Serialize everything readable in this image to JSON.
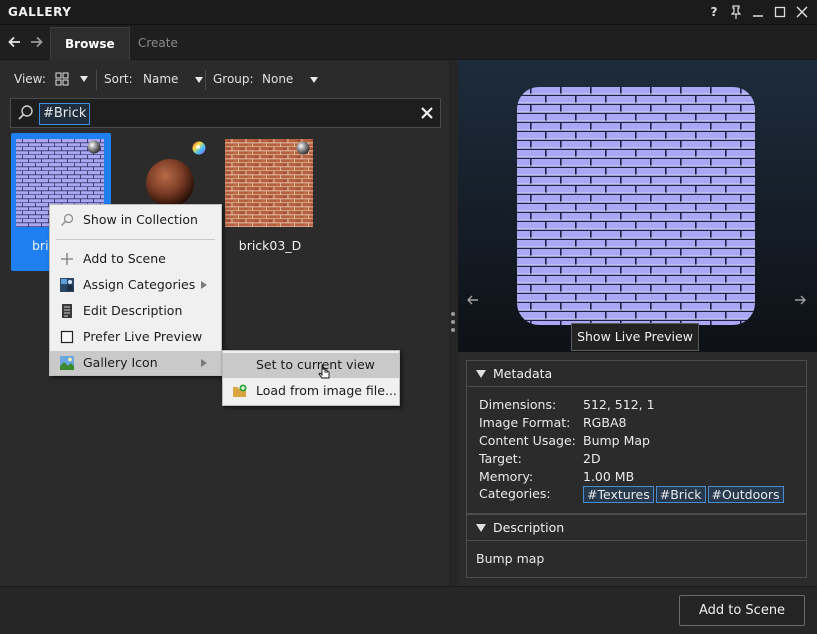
{
  "window": {
    "title": "GALLERY",
    "controls": [
      "?",
      "pin",
      "minimize",
      "maximize",
      "close"
    ]
  },
  "tabs": [
    {
      "label": "Browse",
      "active": true
    },
    {
      "label": "Create",
      "active": false
    }
  ],
  "toolbar": {
    "view_label": "View:",
    "sort_label": "Sort:",
    "sort_value": "Name",
    "group_label": "Group:",
    "group_value": "None"
  },
  "search": {
    "tag": "#Brick"
  },
  "thumbnails": [
    {
      "label": "brick01_N",
      "visible_label": "bric",
      "selected": true,
      "icon": "sphere-icon"
    },
    {
      "label": "",
      "selected": false,
      "icon": "color-wheel-icon"
    },
    {
      "label": "brick03_D",
      "selected": false,
      "icon": "sphere-icon"
    }
  ],
  "context_menu": {
    "items": [
      {
        "label": "Show in Collection",
        "icon": "search-icon"
      },
      {
        "label": "Add to Scene",
        "icon": "plus-icon"
      },
      {
        "label": "Assign Categories",
        "icon": "categories-icon",
        "submenu": true
      },
      {
        "label": "Edit Description",
        "icon": "document-icon"
      },
      {
        "label": "Prefer Live Preview",
        "icon": "checkbox-icon"
      },
      {
        "label": "Gallery Icon",
        "icon": "image-icon",
        "submenu": true,
        "highlighted": true
      }
    ],
    "submenu": [
      {
        "label": "Set to current view",
        "highlighted": true
      },
      {
        "label": "Load from image file...",
        "icon": "folder-add-icon"
      }
    ]
  },
  "preview": {
    "button": "Show Live Preview"
  },
  "metadata": {
    "header": "Metadata",
    "rows": [
      {
        "key": "Dimensions:",
        "value": "512, 512, 1"
      },
      {
        "key": "Image Format:",
        "value": "RGBA8"
      },
      {
        "key": "Content Usage:",
        "value": "Bump Map"
      },
      {
        "key": "Target:",
        "value": "2D"
      },
      {
        "key": "Memory:",
        "value": "1.00 MB"
      }
    ],
    "categories_key": "Categories:",
    "categories": [
      "#Textures",
      "#Brick",
      "#Outdoors"
    ]
  },
  "description": {
    "header": "Description",
    "text": "Bump map"
  },
  "footer": {
    "add_button": "Add to Scene"
  },
  "colors": {
    "selection": "#1e7ff0",
    "accent_tag": "#4a8bd0",
    "brick_normal": "#a9a8f6",
    "brick_diffuse": "#b15a3f"
  }
}
